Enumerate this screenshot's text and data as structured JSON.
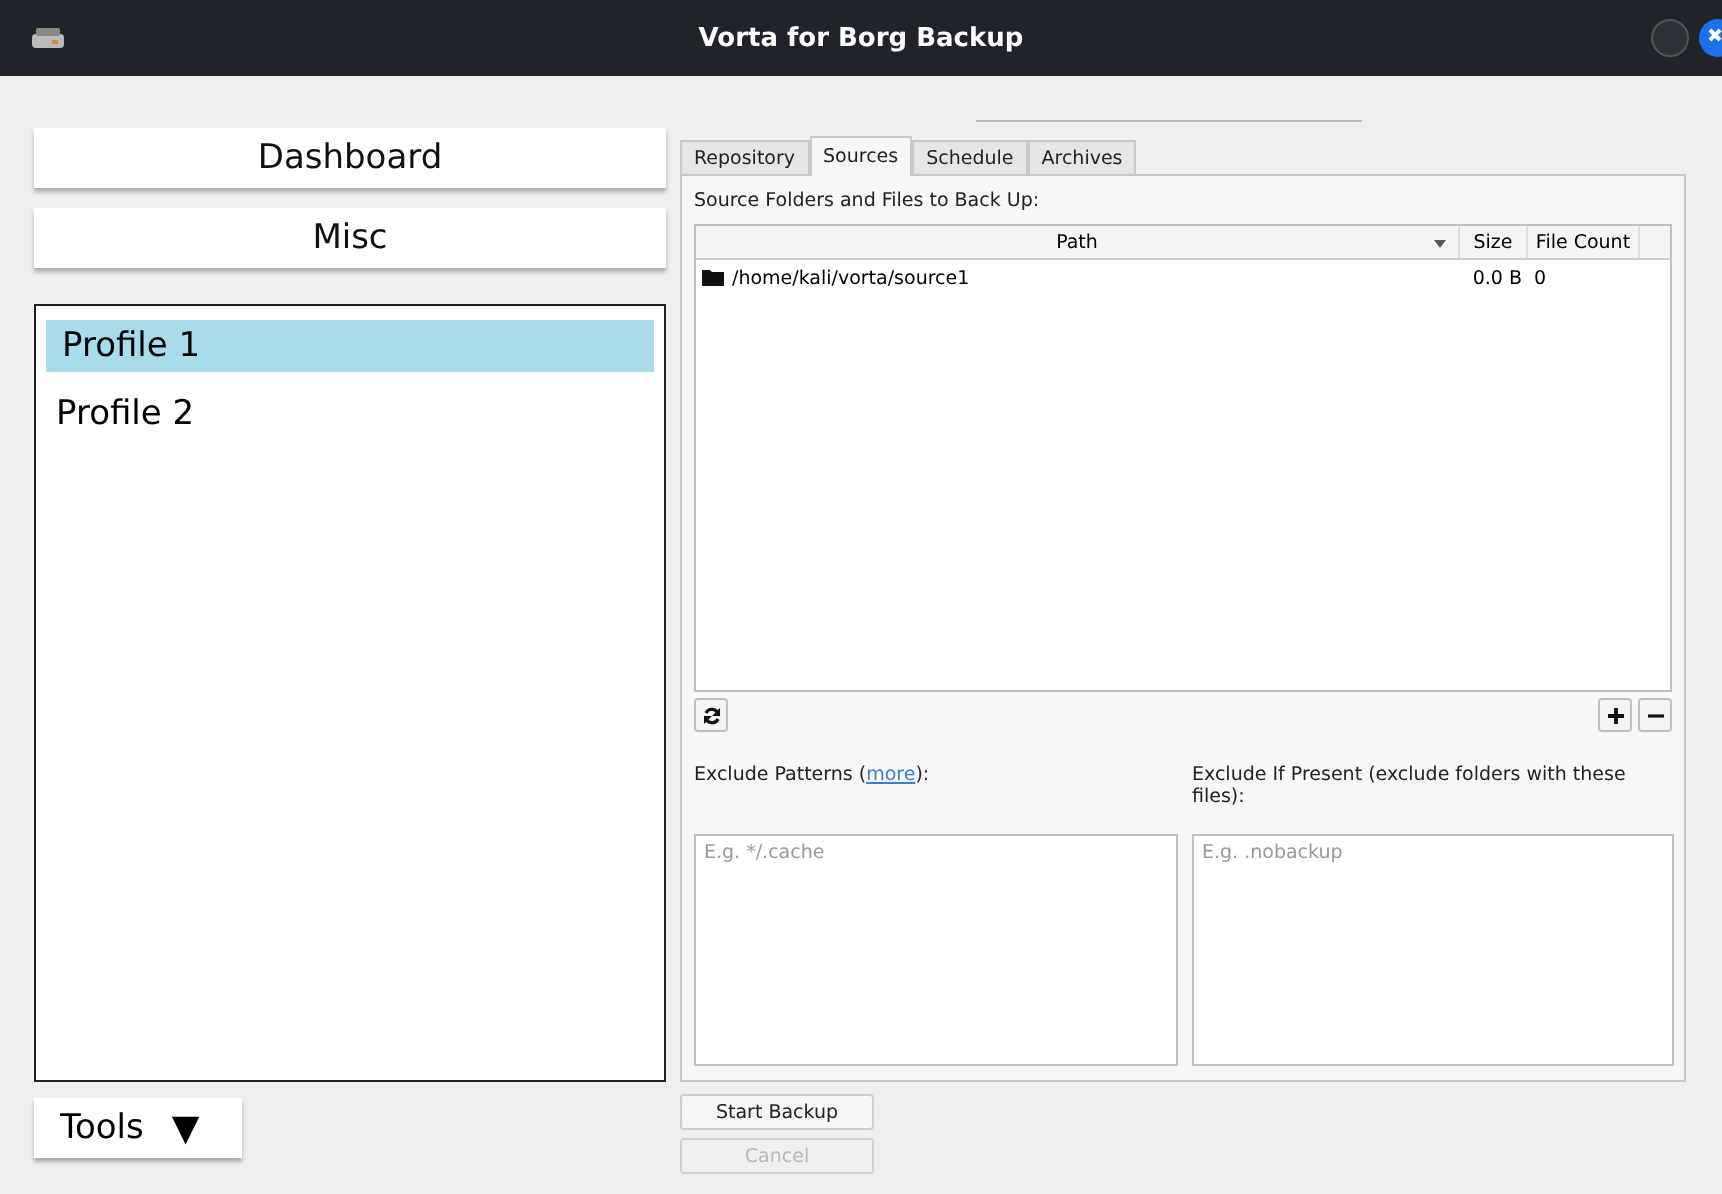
{
  "window": {
    "title": "Vorta for Borg Backup"
  },
  "nav": [
    {
      "label": "Dashboard"
    },
    {
      "label": "Misc"
    }
  ],
  "profiles": [
    {
      "label": "Profile 1",
      "selected": true
    },
    {
      "label": "Profile 2",
      "selected": false
    }
  ],
  "tools": {
    "label": "Tools",
    "caret": "▼"
  },
  "tabs": [
    {
      "label": "Repository",
      "selected": false
    },
    {
      "label": "Sources",
      "selected": true
    },
    {
      "label": "Schedule",
      "selected": false
    },
    {
      "label": "Archives",
      "selected": false
    }
  ],
  "sources": {
    "heading": "Source Folders and Files to Back Up:",
    "columns": [
      "Path",
      "Size",
      "File Count"
    ],
    "rows": [
      {
        "path": "/home/kali/vorta/source1",
        "size": "0.0 B",
        "count": "0"
      }
    ]
  },
  "exclude_patterns": {
    "label": "Exclude Patterns (",
    "link": "more",
    "label_end": "):",
    "placeholder": "E.g. */.cache"
  },
  "exclude_if_present": {
    "label": "Exclude If Present (exclude folders with these files):",
    "placeholder": "E.g. .nobackup"
  },
  "buttons": [
    {
      "label": "Start Backup",
      "disabled": false
    },
    {
      "label": "Cancel",
      "disabled": true
    }
  ]
}
